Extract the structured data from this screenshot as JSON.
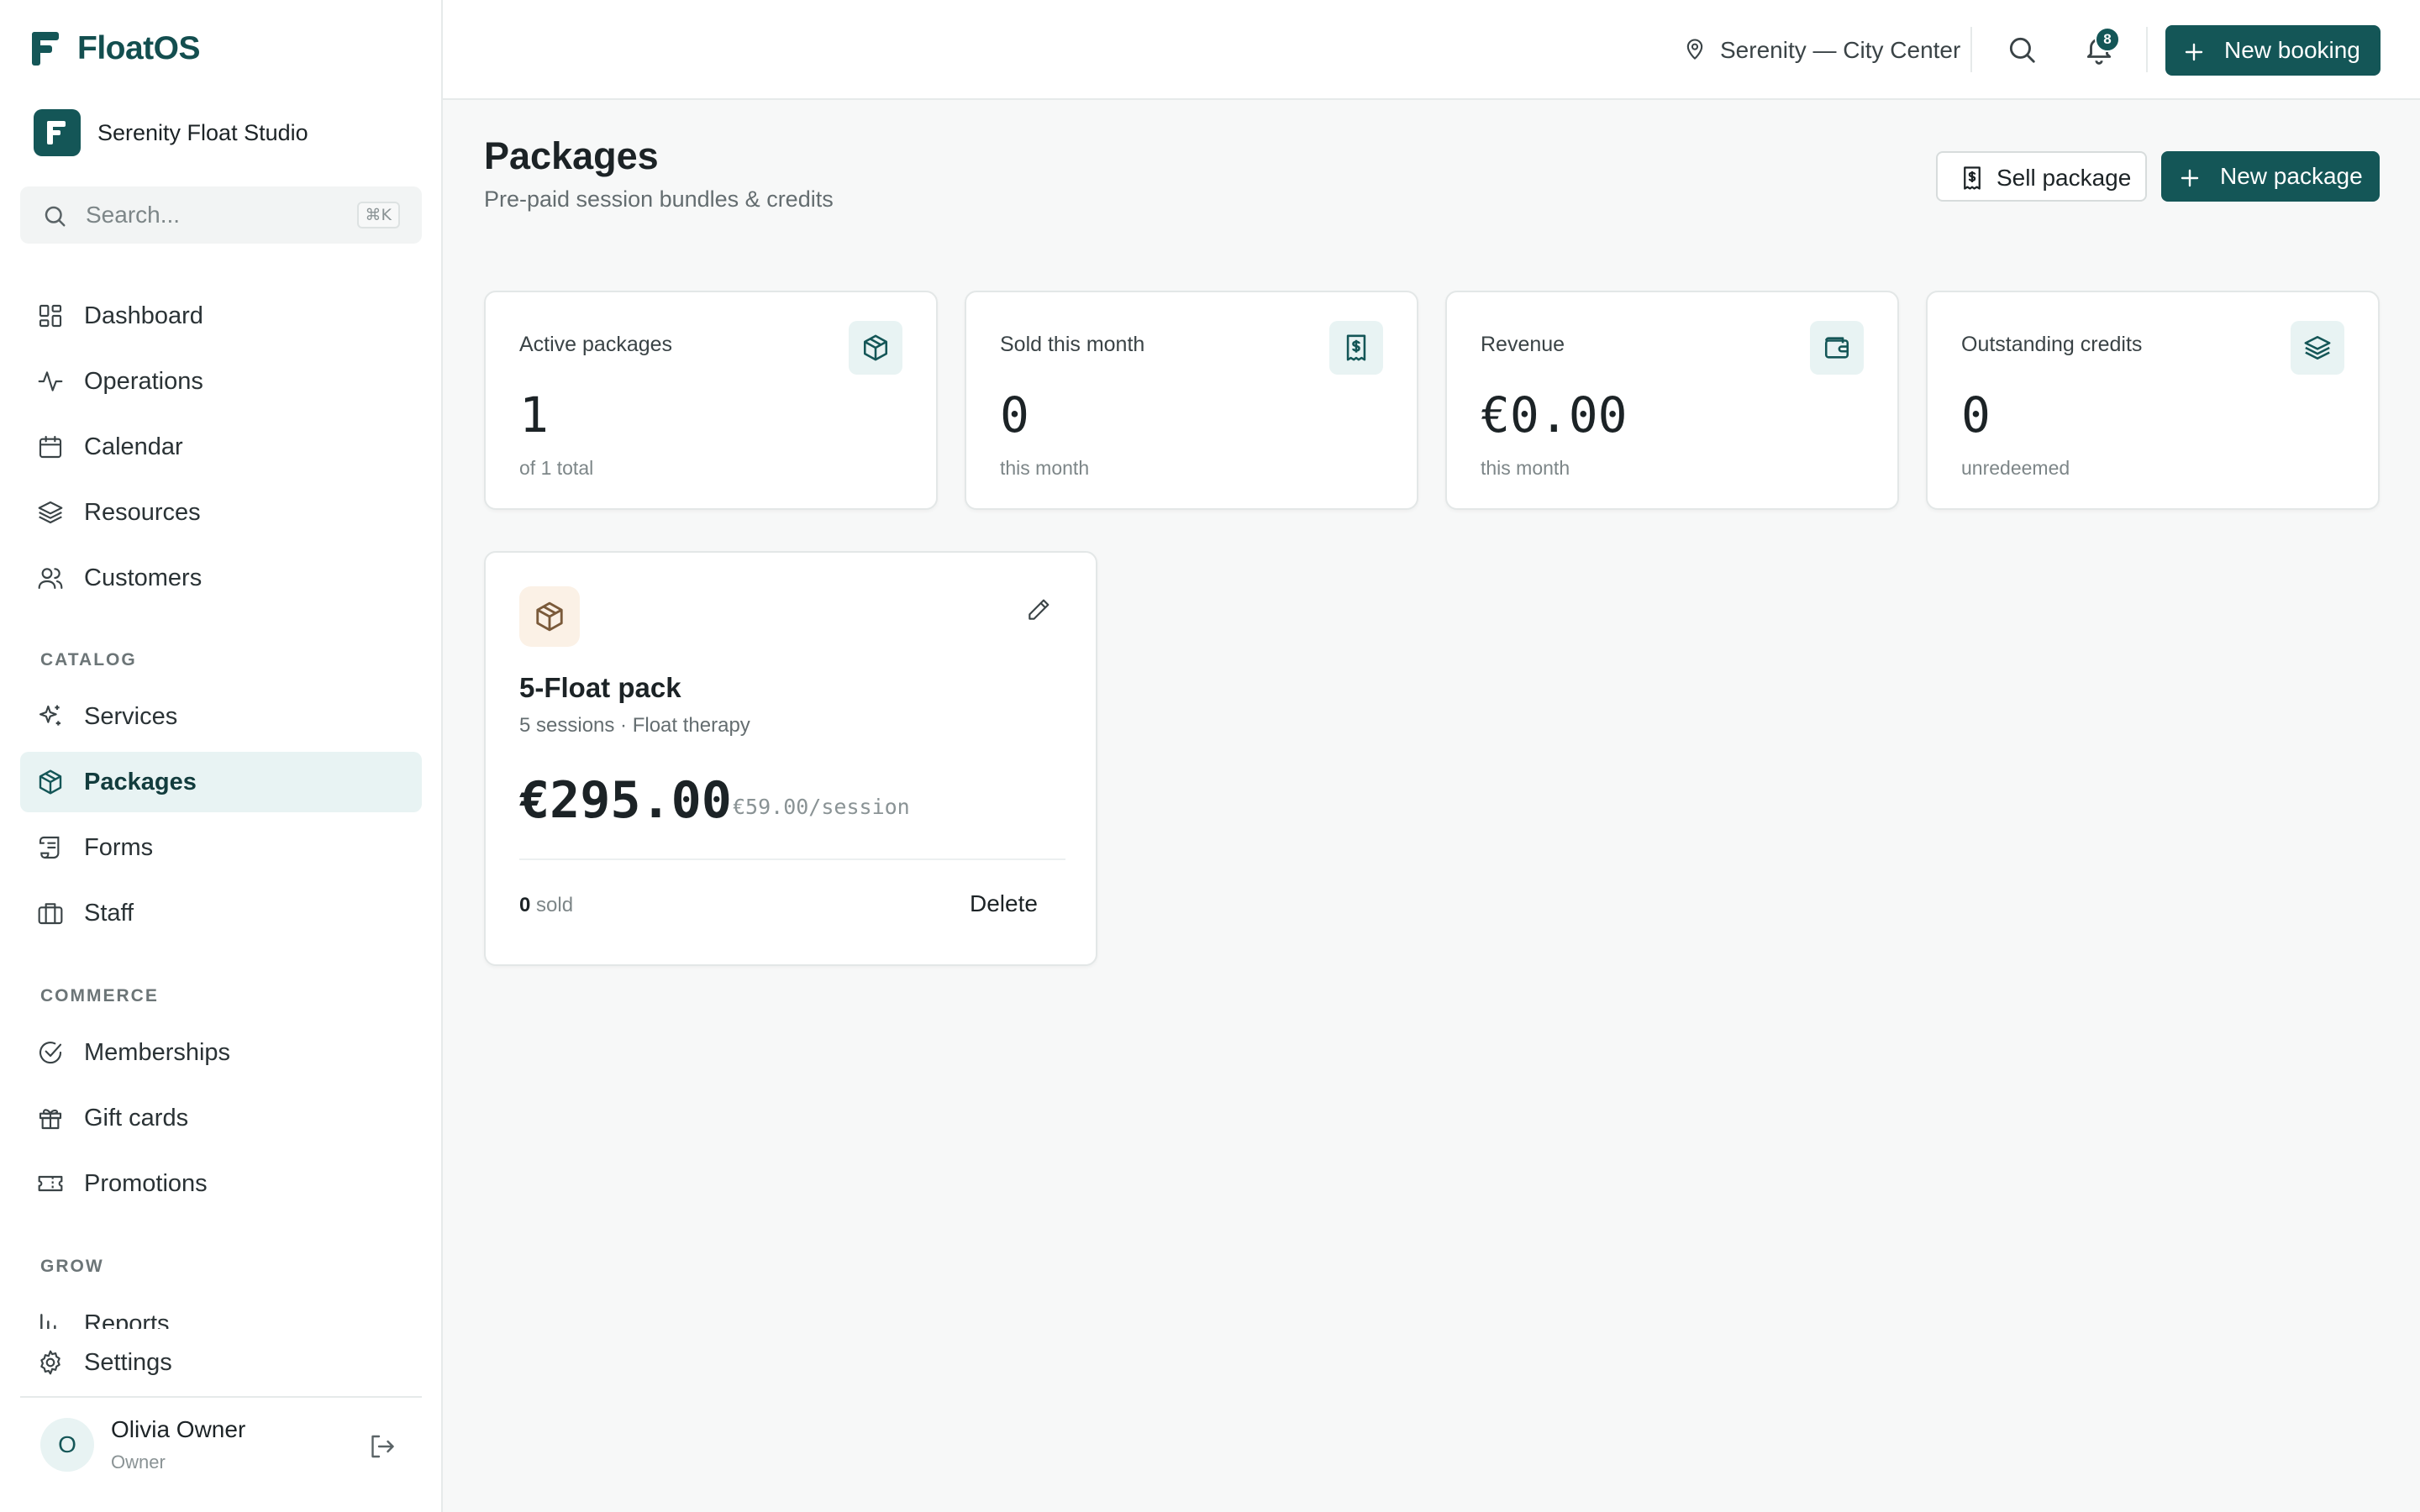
{
  "app": {
    "name": "FloatOS"
  },
  "workspace": {
    "initial": "F",
    "name": "Serenity Float Studio"
  },
  "sidebar": {
    "search": {
      "placeholder": "Search...",
      "shortcut": "⌘K"
    },
    "main_items": [
      {
        "label": "Dashboard",
        "icon": "dashboard-icon"
      },
      {
        "label": "Operations",
        "icon": "activity-icon"
      },
      {
        "label": "Calendar",
        "icon": "calendar-icon"
      },
      {
        "label": "Resources",
        "icon": "layers-icon"
      },
      {
        "label": "Customers",
        "icon": "users-icon"
      }
    ],
    "sections": {
      "catalog": "CATALOG",
      "commerce": "COMMERCE",
      "grow": "GROW"
    },
    "catalog_items": [
      {
        "label": "Services",
        "icon": "sparkles-icon"
      },
      {
        "label": "Packages",
        "icon": "package-icon",
        "active": true
      },
      {
        "label": "Forms",
        "icon": "scroll-icon"
      },
      {
        "label": "Staff",
        "icon": "briefcase-icon"
      }
    ],
    "commerce_items": [
      {
        "label": "Memberships",
        "icon": "check-circle-icon"
      },
      {
        "label": "Gift cards",
        "icon": "gift-icon"
      },
      {
        "label": "Promotions",
        "icon": "ticket-icon"
      }
    ],
    "grow_items": [
      {
        "label": "Reports",
        "icon": "bar-chart-icon"
      }
    ],
    "settings": {
      "label": "Settings",
      "icon": "gear-icon"
    },
    "user": {
      "initial": "O",
      "name": "Olivia Owner",
      "role": "Owner"
    }
  },
  "topbar": {
    "location": "Serenity — City Center",
    "notifications_count": "8",
    "new_booking_label": "New booking"
  },
  "page": {
    "title": "Packages",
    "subtitle": "Pre-paid session bundles & credits",
    "sell_package_label": "Sell package",
    "new_package_label": "New package"
  },
  "stats": [
    {
      "label": "Active packages",
      "value": "1",
      "sub": "of 1 total",
      "icon": "package-icon"
    },
    {
      "label": "Sold this month",
      "value": "0",
      "sub": "this month",
      "icon": "receipt-dollar-icon"
    },
    {
      "label": "Revenue",
      "value": "€0.00",
      "sub": "this month",
      "icon": "wallet-icon"
    },
    {
      "label": "Outstanding credits",
      "value": "0",
      "sub": "unredeemed",
      "icon": "layers-icon"
    }
  ],
  "packages": [
    {
      "name": "5-Float pack",
      "meta": "5 sessions · Float therapy",
      "price": "€295.00",
      "per_session": "€59.00/session",
      "sold_count": "0",
      "sold_label": "sold",
      "delete_label": "Delete"
    }
  ],
  "colors": {
    "brand": "#145657",
    "brand_text": "#134e4f",
    "active_nav_bg": "#e8f3f3",
    "package_icon_bg": "#fbf1e6",
    "package_icon_stroke": "#7a5a3a"
  }
}
